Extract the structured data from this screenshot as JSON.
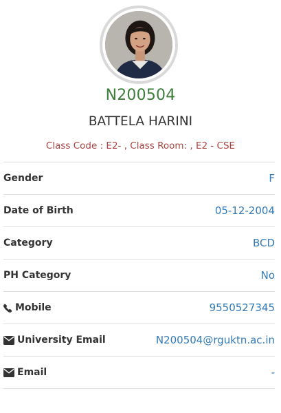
{
  "profile": {
    "id_number": "N200504",
    "name": "BATTELA HARINI",
    "class_info": "Class Code : E2- , Class Room: , E2 - CSE"
  },
  "details": [
    {
      "label": "Gender",
      "value": "F",
      "icon": ""
    },
    {
      "label": "Date of Birth",
      "value": "05-12-2004",
      "icon": ""
    },
    {
      "label": "Category",
      "value": "BCD",
      "icon": ""
    },
    {
      "label": "PH Category",
      "value": "No",
      "icon": ""
    },
    {
      "label": "Mobile",
      "value": "9550527345",
      "icon": "phone-icon"
    },
    {
      "label": "University Email",
      "value": "N200504@rguktn.ac.in",
      "icon": "envelope-icon"
    },
    {
      "label": "Email",
      "value": "-",
      "icon": "envelope-icon"
    }
  ],
  "colors": {
    "id_number": "#3c7d3a",
    "class_info": "#a94442",
    "value_link": "#337ab7",
    "divider": "#dddddd"
  }
}
